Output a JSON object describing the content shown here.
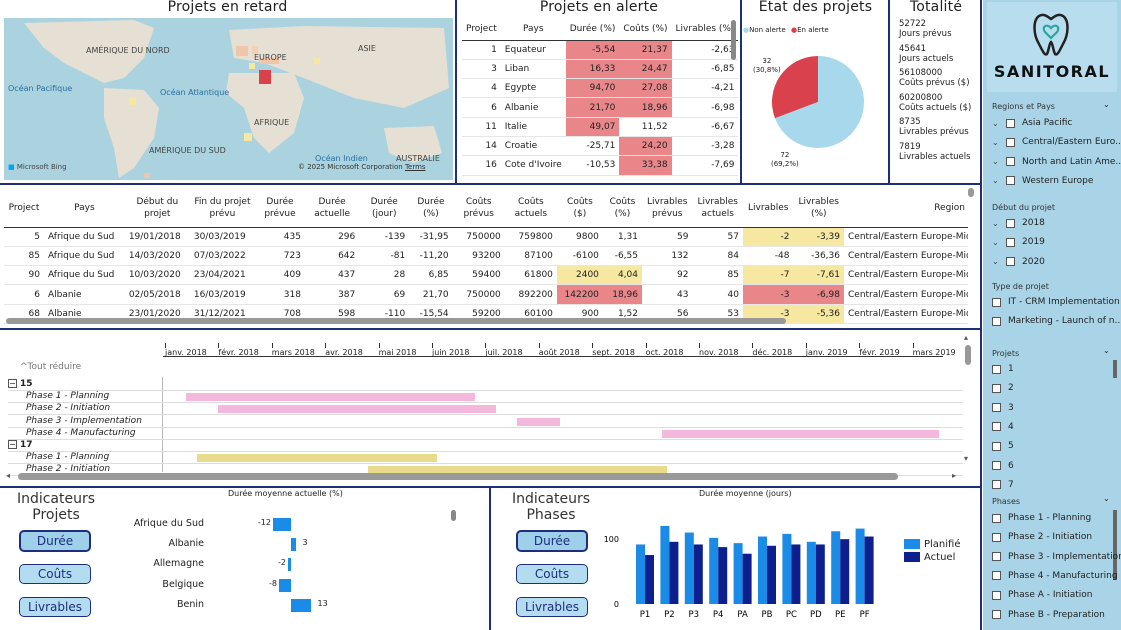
{
  "map": {
    "title": "Projets en retard",
    "labels": [
      {
        "text": "AMÉRIQUE DU NORD",
        "x": 82,
        "y": 28
      },
      {
        "text": "EUROPE",
        "x": 250,
        "y": 35
      },
      {
        "text": "ASIE",
        "x": 354,
        "y": 26
      },
      {
        "text": "Océan Pacifique",
        "x": 4,
        "y": 66
      },
      {
        "text": "Océan Atlantique",
        "x": 156,
        "y": 70
      },
      {
        "text": "AFRIQUE",
        "x": 250,
        "y": 100
      },
      {
        "text": "AMÉRIQUE DU SUD",
        "x": 145,
        "y": 128
      },
      {
        "text": "Océan Indien",
        "x": 311,
        "y": 136
      },
      {
        "text": "AUSTRALIE",
        "x": 392,
        "y": 136
      }
    ],
    "attribution": "© 2025 Microsoft Corporation",
    "terms": "Terms",
    "bing": "Microsoft Bing"
  },
  "alert": {
    "title": "Projets en alerte",
    "headers": [
      "Project",
      "Pays",
      "Durée (%)",
      "Coûts (%)",
      "Livrables (%)"
    ],
    "rows": [
      [
        "1",
        "Equateur",
        "-5,54",
        "21,37",
        "-2,63"
      ],
      [
        "3",
        "Liban",
        "16,33",
        "24,47",
        "-6,85"
      ],
      [
        "4",
        "Egypte",
        "94,70",
        "27,08",
        "-4,21"
      ],
      [
        "6",
        "Albanie",
        "21,70",
        "18,96",
        "-6,98"
      ],
      [
        "11",
        "Italie",
        "49,07",
        "11,52",
        "-6,67"
      ],
      [
        "14",
        "Croatie",
        "-25,71",
        "24,20",
        "-3,28"
      ],
      [
        "16",
        "Cote d'Ivoire",
        "-10,53",
        "33,38",
        "-7,69"
      ]
    ],
    "hl": [
      [
        0,
        1,
        1,
        0
      ],
      [
        0,
        1,
        1,
        0
      ],
      [
        0,
        1,
        1,
        0
      ],
      [
        0,
        1,
        1,
        0
      ],
      [
        0,
        1,
        0,
        0
      ],
      [
        0,
        0,
        1,
        0
      ],
      [
        0,
        0,
        1,
        0
      ]
    ]
  },
  "etat": {
    "title": "Etat des projets",
    "legend_ok": "Non alerte",
    "legend_alert": "En alerte",
    "label_alert": "32",
    "label_alert_pct": "(30,8%)",
    "label_ok": "72",
    "label_ok_pct": "(69,2%)"
  },
  "chart_data": [
    {
      "type": "pie",
      "title": "Etat des projets",
      "categories": [
        "Non alerte",
        "En alerte"
      ],
      "values": [
        72,
        32
      ]
    },
    {
      "type": "bar",
      "title": "Durée moyenne actuelle (%)",
      "categories": [
        "Afrique du Sud",
        "Albanie",
        "Allemagne",
        "Belgique",
        "Benin"
      ],
      "values": [
        -12,
        3,
        -2,
        -8,
        13
      ]
    },
    {
      "type": "bar",
      "title": "Durée moyenne (jours)",
      "categories": [
        "P1",
        "P2",
        "P3",
        "P4",
        "PA",
        "PB",
        "PC",
        "PD",
        "PE",
        "PF"
      ],
      "series": [
        {
          "name": "Planifié",
          "values": [
            90,
            118,
            108,
            100,
            92,
            102,
            106,
            94,
            110,
            114
          ]
        },
        {
          "name": "Actuel",
          "values": [
            74,
            94,
            90,
            86,
            76,
            88,
            90,
            90,
            98,
            102
          ]
        }
      ],
      "ylim": [
        0,
        130
      ],
      "ticks": [
        "0",
        "100"
      ]
    }
  ],
  "totalite": {
    "title": "Totalité",
    "items": [
      {
        "v": "52722",
        "l": "Jours prévus"
      },
      {
        "v": "45641",
        "l": "Jours actuels"
      },
      {
        "v": "56108000",
        "l": "Coûts prévus ($)"
      },
      {
        "v": "60200800",
        "l": "Coûts actuels ($)"
      },
      {
        "v": "8735",
        "l": "Livrables prévus"
      },
      {
        "v": "7819",
        "l": "Livrables actuels"
      }
    ]
  },
  "detail": {
    "headers": [
      "Project",
      "Pays",
      "Début du projet",
      "Fin du projet prévu",
      "Durée prévue",
      "Durée actuelle",
      "Durée (jour)",
      "Durée (%)",
      "Coûts prévus",
      "Coûts actuels",
      "Coûts ($)",
      "Coûts (%)",
      "Livrables prévus",
      "Livrables actuels",
      "Livrables",
      "Livrables (%)",
      "Region"
    ],
    "rows": [
      [
        "5",
        "Afrique du Sud",
        "19/01/2018",
        "30/03/2019",
        "435",
        "296",
        "-139",
        "-31,95",
        "750000",
        "759800",
        "9800",
        "1,31",
        "59",
        "57",
        "-2",
        "-3,39",
        "Central/Eastern Europe-Mid"
      ],
      [
        "85",
        "Afrique du Sud",
        "14/03/2020",
        "07/03/2022",
        "723",
        "642",
        "-81",
        "-11,20",
        "93200",
        "87100",
        "-6100",
        "-6,55",
        "132",
        "84",
        "-48",
        "-36,36",
        "Central/Eastern Europe-Mid"
      ],
      [
        "90",
        "Afrique du Sud",
        "10/03/2020",
        "23/04/2021",
        "409",
        "437",
        "28",
        "6,85",
        "59400",
        "61800",
        "2400",
        "4,04",
        "92",
        "85",
        "-7",
        "-7,61",
        "Central/Eastern Europe-Mid"
      ],
      [
        "6",
        "Albanie",
        "02/05/2018",
        "16/03/2019",
        "318",
        "387",
        "69",
        "21,70",
        "750000",
        "892200",
        "142200",
        "18,96",
        "43",
        "40",
        "-3",
        "-6,98",
        "Central/Eastern Europe-Mid"
      ],
      [
        "68",
        "Albanie",
        "23/01/2020",
        "31/12/2021",
        "708",
        "598",
        "-110",
        "-15,54",
        "59200",
        "60100",
        "900",
        "1,52",
        "56",
        "53",
        "-3",
        "-5,36",
        "Central/Eastern Europe-Mid"
      ]
    ],
    "hl": [
      [
        0,
        0,
        0,
        0,
        0,
        0,
        0,
        0,
        0,
        0,
        1,
        1
      ],
      [
        0,
        0,
        0,
        0,
        0,
        0,
        0,
        0,
        0,
        0,
        0,
        0
      ],
      [
        0,
        0,
        0,
        0,
        0,
        0,
        1,
        1,
        0,
        0,
        1,
        1
      ],
      [
        0,
        0,
        0,
        0,
        0,
        0,
        2,
        2,
        0,
        0,
        2,
        2
      ],
      [
        0,
        0,
        0,
        0,
        0,
        0,
        0,
        0,
        0,
        0,
        1,
        1
      ]
    ]
  },
  "gantt": {
    "collapse": "Tout réduire",
    "months": [
      "janv. 2018",
      "févr. 2018",
      "mars 2018",
      "avr. 2018",
      "mai 2018",
      "juin 2018",
      "juil. 2018",
      "août 2018",
      "sept. 2018",
      "oct. 2018",
      "nov. 2018",
      "déc. 2018",
      "janv. 2019",
      "févr. 2019",
      "mars 2019"
    ],
    "rows": [
      {
        "type": "group",
        "label": "15"
      },
      {
        "type": "task",
        "label": "Phase 1 - Planning",
        "start": 0.4,
        "end": 5.8,
        "color": "#f4b8dc"
      },
      {
        "type": "task",
        "label": "Phase 2 - Initiation",
        "start": 1.0,
        "end": 6.2,
        "color": "#f4b8dc"
      },
      {
        "type": "task",
        "label": "Phase 3 - Implementation",
        "start": 6.6,
        "end": 7.4,
        "color": "#f4b8dc"
      },
      {
        "type": "task",
        "label": "Phase 4 - Manufacturing",
        "start": 9.3,
        "end": 14.5,
        "color": "#f4b8dc"
      },
      {
        "type": "group",
        "label": "17"
      },
      {
        "type": "task",
        "label": "Phase 1 - Planning",
        "start": 0.6,
        "end": 5.1,
        "color": "#e8dc8c"
      },
      {
        "type": "task",
        "label": "Phase 2 - Initiation",
        "start": 3.8,
        "end": 9.4,
        "color": "#e8dc8c"
      }
    ]
  },
  "ind_proj": {
    "title1": "Indicateurs",
    "title2": "Projets",
    "btns": [
      "Durée",
      "Coûts",
      "Livrables"
    ],
    "chart_title": "Durée moyenne actuelle (%)",
    "labels": [
      "-12",
      "3",
      "-2",
      "-8",
      "13"
    ]
  },
  "ind_phase": {
    "title1": "Indicateurs",
    "title2": "Phases",
    "btns": [
      "Durée",
      "Coûts",
      "Livrables"
    ],
    "chart_title": "Durée moyenne (jours)",
    "legend": [
      "Planifié",
      "Actuel"
    ],
    "colors": [
      "#1a8ce8",
      "#0d1f8c"
    ]
  },
  "sidebar": {
    "brand": "SANITORAL",
    "region_title": "Regions et Pays",
    "regions": [
      "Asia Pacific",
      "Central/Eastern Euro...",
      "North and Latin Ame...",
      "Western Europe"
    ],
    "date_title": "Début du projet",
    "years": [
      "2018",
      "2019",
      "2020"
    ],
    "type_title": "Type de projet",
    "types": [
      "IT - CRM Implementation",
      "Marketing - Launch of n..."
    ],
    "proj_title": "Projets",
    "projects": [
      "1",
      "2",
      "3",
      "4",
      "5",
      "6",
      "7"
    ],
    "phase_title": "Phases",
    "phases": [
      "Phase 1 - Planning",
      "Phase 2 - Initiation",
      "Phase 3 - Implementation",
      "Phase 4 - Manufacturing",
      "Phase A - Initiation",
      "Phase B - Preparation"
    ]
  },
  "colors": {
    "navy": "#1f2e7a",
    "pie_ok": "#a8d8ec",
    "pie_alert": "#d9414d",
    "bar": "#1a8ce8"
  }
}
